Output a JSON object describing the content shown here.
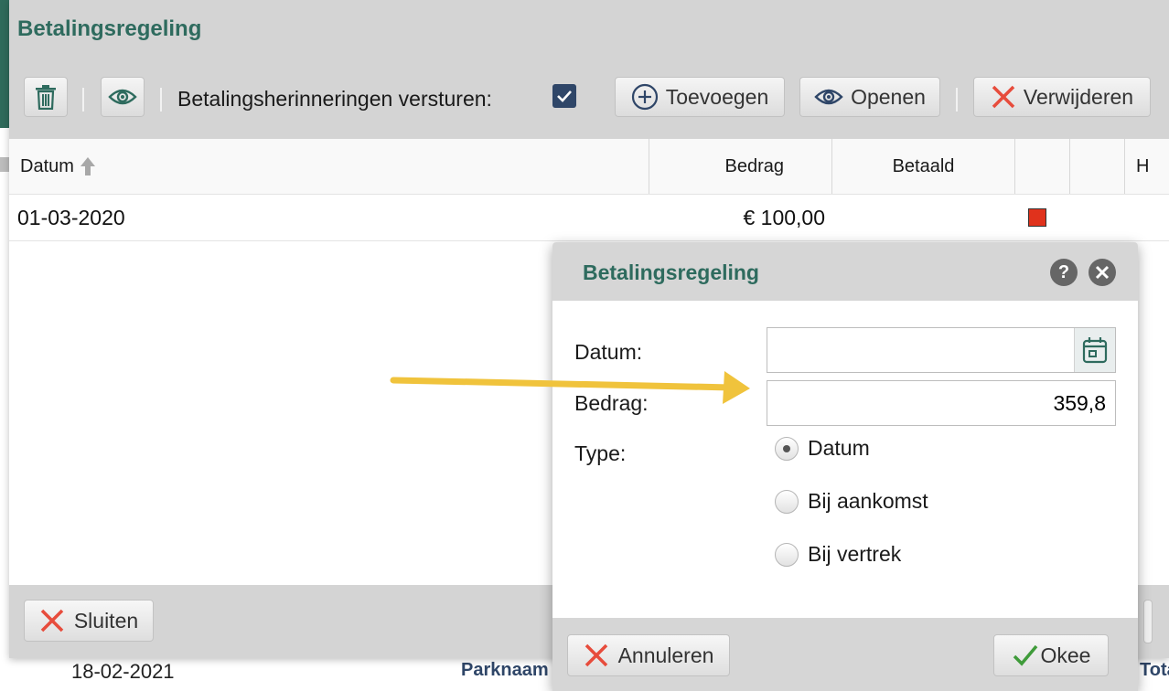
{
  "window": {
    "title": "Betalingsregeling",
    "toolbar": {
      "reminders_label": "Betalingsherinneringen versturen:",
      "reminders_checked": true,
      "add_label": "Toevoegen",
      "open_label": "Openen",
      "delete_label": "Verwijderen"
    },
    "table": {
      "columns": [
        "Datum",
        "Bedrag",
        "Betaald",
        "",
        "",
        "H"
      ],
      "rows": [
        {
          "datum": "01-03-2020",
          "bedrag": "€ 100,00",
          "status_color": "#e0321c"
        }
      ]
    },
    "footer": {
      "close_label": "Sluiten"
    }
  },
  "dialog": {
    "title": "Betalingsregeling",
    "fields": {
      "datum_label": "Datum:",
      "datum_value": "",
      "bedrag_label": "Bedrag:",
      "bedrag_value": "359,8",
      "type_label": "Type:"
    },
    "type_options": [
      {
        "label": "Datum",
        "selected": true
      },
      {
        "label": "Bij aankomst",
        "selected": false
      },
      {
        "label": "Bij vertrek",
        "selected": false
      }
    ],
    "cancel_label": "Annuleren",
    "ok_label": "Okee"
  },
  "background": {
    "row_date": "18-02-2021",
    "park_label": "Parknaam",
    "total_label": "Totaal"
  },
  "colors": {
    "accent": "#2e6b5e",
    "checkbox": "#2f4668",
    "danger": "#e74c3c",
    "ok": "#3f9b3a",
    "annotation_arrow": "#f0c33c"
  }
}
